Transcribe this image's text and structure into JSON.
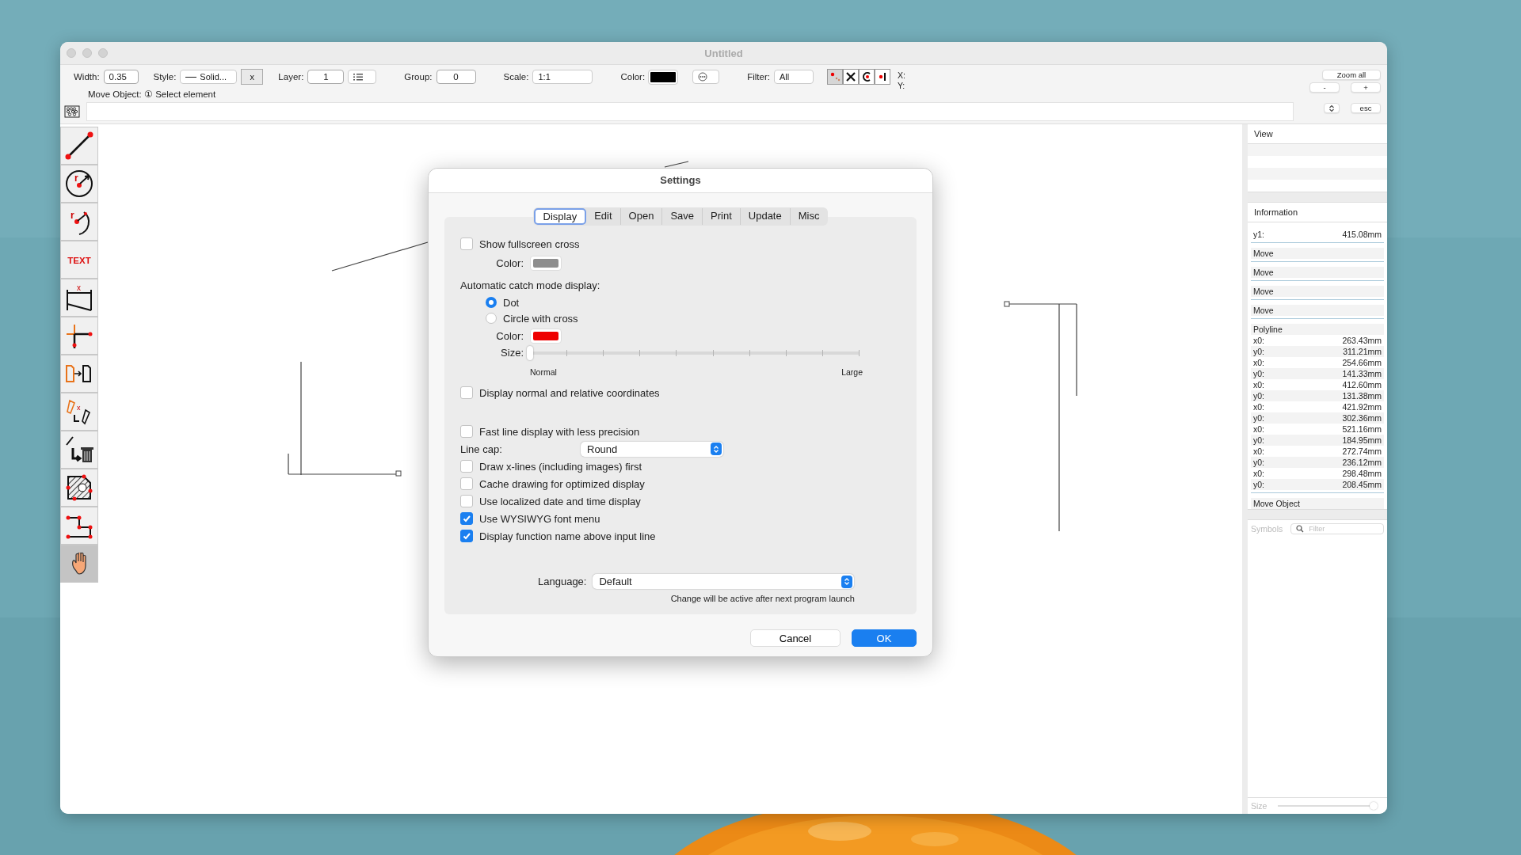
{
  "window": {
    "title": "Untitled"
  },
  "toolbar": {
    "width_label": "Width:",
    "width_value": "0.35",
    "style_label": "Style:",
    "style_value": "Solid...",
    "clear_button": "x",
    "layer_label": "Layer:",
    "layer_value": "1",
    "group_label": "Group:",
    "group_value": "0",
    "scale_label": "Scale:",
    "scale_value": "1:1",
    "color_label": "Color:",
    "color": "#000000",
    "filter_label": "Filter:",
    "filter_value": "All",
    "catch_buttons": [
      {
        "kind": "points",
        "selected": true
      },
      {
        "kind": "cross",
        "selected": false
      },
      {
        "kind": "center",
        "selected": false
      },
      {
        "kind": "end",
        "selected": false
      }
    ],
    "x_label": "X:",
    "y_label": "Y:",
    "zoom_all": "Zoom all",
    "zoom_out": "-",
    "zoom_in": "+",
    "esc": "esc"
  },
  "status_text": "Move Object: ① Select element",
  "tools": [
    {
      "kind": "line",
      "selected": false
    },
    {
      "kind": "circle",
      "label": "r",
      "selected": false
    },
    {
      "kind": "arc",
      "label": "r",
      "selected": false
    },
    {
      "kind": "text",
      "label": "TEXT",
      "selected": false
    },
    {
      "kind": "dimension",
      "label": "x",
      "selected": false
    },
    {
      "kind": "perpendicular",
      "selected": false
    },
    {
      "kind": "copy",
      "selected": false
    },
    {
      "kind": "edit",
      "label": "x",
      "selected": false
    },
    {
      "kind": "delete",
      "selected": false
    },
    {
      "kind": "hatch",
      "selected": false
    },
    {
      "kind": "polyline",
      "selected": false
    },
    {
      "kind": "hand",
      "selected": true
    }
  ],
  "panel": {
    "view_title": "View",
    "info_title": "Information",
    "sections": [
      {
        "rows": [
          {
            "label": "y1:",
            "value": "415.08mm"
          }
        ]
      },
      {
        "title": "Move"
      },
      {
        "title": "Move"
      },
      {
        "title": "Move"
      },
      {
        "title": "Move"
      },
      {
        "title": "Polyline",
        "rows": [
          {
            "label": "x0:",
            "value": "263.43mm"
          },
          {
            "label": "y0:",
            "value": "311.21mm"
          },
          {
            "label": "x0:",
            "value": "254.66mm"
          },
          {
            "label": "y0:",
            "value": "141.33mm"
          },
          {
            "label": "x0:",
            "value": "412.60mm"
          },
          {
            "label": "y0:",
            "value": "131.38mm"
          },
          {
            "label": "x0:",
            "value": "421.92mm"
          },
          {
            "label": "y0:",
            "value": "302.36mm"
          },
          {
            "label": "x0:",
            "value": "521.16mm"
          },
          {
            "label": "y0:",
            "value": "184.95mm"
          },
          {
            "label": "x0:",
            "value": "272.74mm"
          },
          {
            "label": "y0:",
            "value": "236.12mm"
          },
          {
            "label": "x0:",
            "value": "298.48mm"
          },
          {
            "label": "y0:",
            "value": "208.45mm"
          }
        ]
      }
    ],
    "footer": "Move Object",
    "symbols_title": "Symbols",
    "filter_placeholder": "Filter",
    "size": {
      "label": "Size",
      "level": 1
    }
  },
  "settings": {
    "title": "Settings",
    "tabs": [
      {
        "label": "Display",
        "selected": true
      },
      {
        "label": "Edit",
        "selected": false
      },
      {
        "label": "Open",
        "selected": false
      },
      {
        "label": "Save",
        "selected": false
      },
      {
        "label": "Print",
        "selected": false
      },
      {
        "label": "Update",
        "selected": false
      },
      {
        "label": "Misc",
        "selected": false
      }
    ],
    "groups": [
      [
        {
          "kind": "checkbox",
          "label": "Show fullscreen cross",
          "checked": false
        },
        {
          "kind": "color",
          "label": "Color:",
          "color": "#8e8e8e"
        },
        {
          "kind": "heading",
          "label": "Automatic catch mode display:"
        },
        {
          "kind": "radio",
          "label": "Dot",
          "selected": true
        },
        {
          "kind": "radio",
          "label": "Circle with cross",
          "selected": false
        },
        {
          "kind": "color",
          "label": "Color:",
          "color": "#ee0000"
        },
        {
          "kind": "slider",
          "label": "Size:",
          "level": 0,
          "min_label": "Normal",
          "max_label": "Large"
        },
        {
          "kind": "checkbox",
          "label": "Display normal and relative coordinates",
          "checked": false
        }
      ],
      [
        {
          "kind": "checkbox",
          "label": "Fast line display with less precision",
          "checked": false
        },
        {
          "kind": "select",
          "label": "Line cap:",
          "value": "Round"
        },
        {
          "kind": "checkbox",
          "label": "Draw x-lines (including images) first",
          "checked": false
        },
        {
          "kind": "checkbox",
          "label": "Cache drawing for optimized display",
          "checked": false
        },
        {
          "kind": "checkbox",
          "label": "Use localized date and time display",
          "checked": false
        },
        {
          "kind": "checkbox",
          "label": "Use WYSIWYG font menu",
          "checked": true
        },
        {
          "kind": "checkbox",
          "label": "Display function name above input line",
          "checked": true
        }
      ]
    ],
    "language": {
      "label": "Language:",
      "value": "Default",
      "note": "Change will be active after next program launch"
    },
    "buttons": [
      {
        "label": "Cancel",
        "default": false
      },
      {
        "label": "OK",
        "default": true
      }
    ]
  }
}
